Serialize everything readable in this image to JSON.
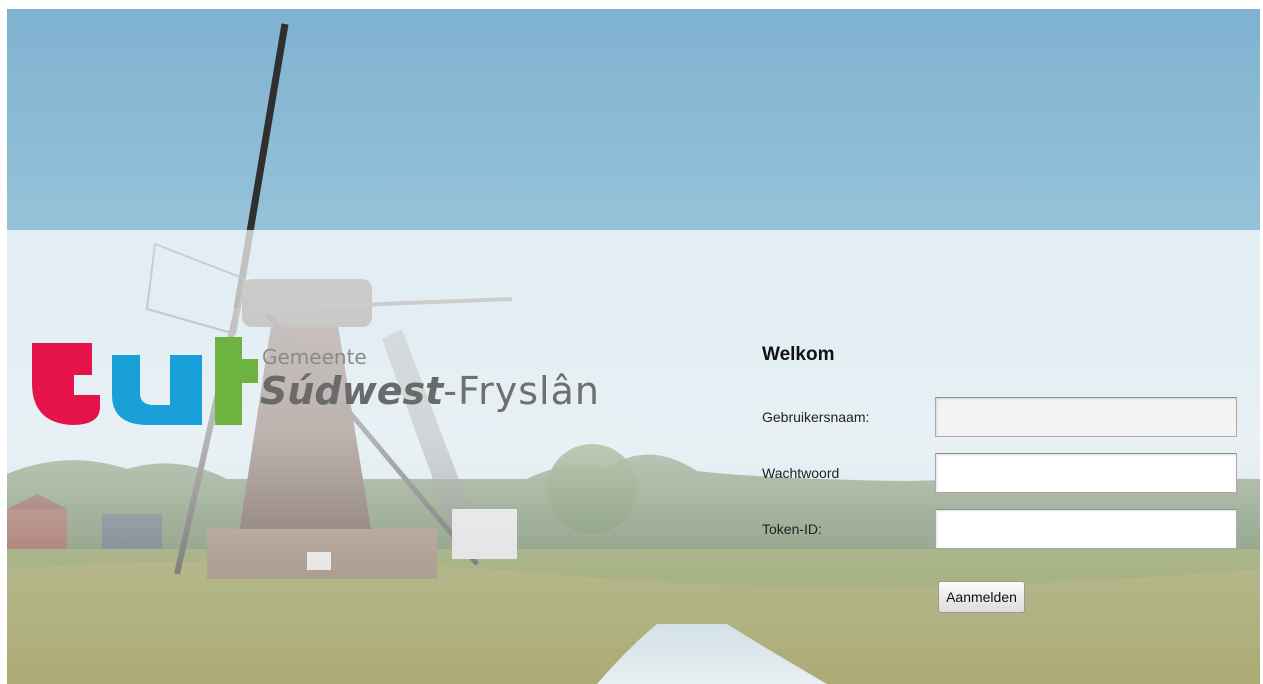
{
  "brand": {
    "prefix": "Gemeente",
    "name_bold": "Súdwest",
    "name_rest": "-Fryslân",
    "colors": {
      "red": "#e4144a",
      "blue": "#1aa0d8",
      "green": "#6cb33f",
      "text": "#6f6f6f"
    }
  },
  "login": {
    "title": "Welkom",
    "username_label": "Gebruikersnaam:",
    "username_value": "",
    "password_label": "Wachtwoord",
    "password_value": "",
    "token_label": "Token-ID:",
    "token_value": "",
    "submit_label": "Aanmelden"
  },
  "background": {
    "scene": "windmill-landscape",
    "sky": "#8db9d3",
    "grass": "#8e9a52"
  }
}
